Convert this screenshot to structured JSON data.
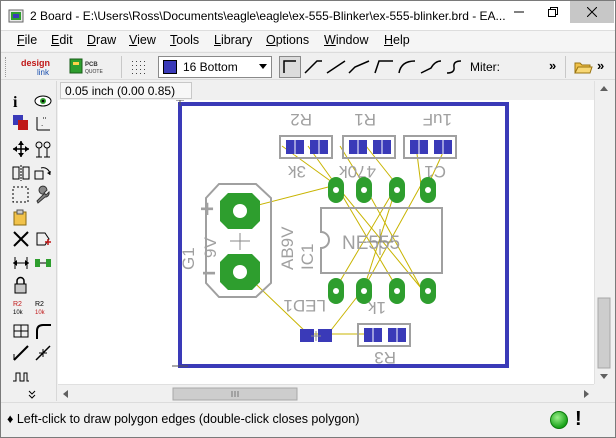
{
  "window": {
    "title": "2 Board - E:\\Users\\Ross\\Documents\\eagle\\eagle\\ex-555-Blinker\\ex-555-blinker.brd - EA..."
  },
  "menubar": {
    "items": [
      {
        "label": "File",
        "underline": "F"
      },
      {
        "label": "Edit",
        "underline": "E"
      },
      {
        "label": "Draw",
        "underline": "D"
      },
      {
        "label": "View",
        "underline": "V"
      },
      {
        "label": "Tools",
        "underline": "T"
      },
      {
        "label": "Library",
        "underline": "L"
      },
      {
        "label": "Options",
        "underline": "O"
      },
      {
        "label": "Window",
        "underline": "W"
      },
      {
        "label": "Help",
        "underline": "H"
      }
    ]
  },
  "toolbar": {
    "designlink_label": "design link",
    "pcbquote_label": "PCB QUOTE",
    "layer_value": "16 Bottom",
    "layer_color": "#3a3ab8",
    "miter_label": "Miter:",
    "more_label": "»",
    "more_label_2": "»"
  },
  "coordinates": {
    "readout": "0.05 inch (0.00 0.85)"
  },
  "board": {
    "outline_color": "#3a3ab8",
    "pad_color": "#2e9e2e",
    "silk_color": "#a0a0a0",
    "airwire_color": "#c8b400",
    "labels": {
      "r2": "R2",
      "r1": "R1",
      "c1_value": "1uF",
      "r2_value": "3k",
      "r1_value": "470k",
      "c1": "C1",
      "ic_name": "NE555",
      "ic_ref": "IC1",
      "battery_ref": "G1",
      "battery_value": "9V",
      "battery_model": "AB9V",
      "led_ref": "LED1",
      "r3_value": "1k",
      "r3": "R3",
      "plus": "+",
      "minus": "−"
    }
  },
  "status": {
    "message": "♦ Left-click to draw polygon edges (double-click closes polygon)",
    "alert": "!"
  }
}
